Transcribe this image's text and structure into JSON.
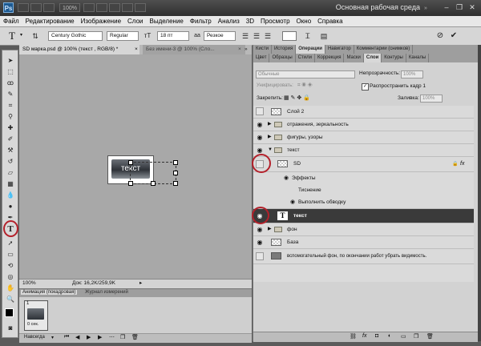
{
  "titlebar": {
    "logo": "Ps",
    "zoom": "100%",
    "workspace": "Основная рабочая среда",
    "win_minimize": "–",
    "win_restore": "❐",
    "win_close": "✕"
  },
  "menu": [
    "Файл",
    "Редактирование",
    "Изображение",
    "Слои",
    "Выделение",
    "Фильтр",
    "Анализ",
    "3D",
    "Просмотр",
    "Окно",
    "Справка"
  ],
  "options": {
    "tool_glyph": "T",
    "font_family": "Century Gothic",
    "font_style": "Regular",
    "font_size": "18 пт",
    "aa": "Резкое"
  },
  "document": {
    "tab1": "SD марка.psd @ 100% (текст , RGB/8) *",
    "tab1_close": "×",
    "tab2": "Без имени-3 @ 100% (Сло...",
    "tab2_close": "×",
    "tab_more": "»",
    "canvas_text": "текст",
    "zoom": "100%",
    "doc_info": "Док: 16,2K/259,9K"
  },
  "animation": {
    "tab_anim": "Анимация (покадровая)",
    "tab_log": "Журнал измерений",
    "frame_number": "1",
    "frame_delay": "0 сек.",
    "loop": "Навсегда"
  },
  "panels": {
    "tabs_top": [
      "Кисти",
      "История",
      "Операции",
      "Навигатор",
      "Комментарии (снимков)"
    ],
    "tabs_layers": [
      "Цвет",
      "Образцы",
      "Стили",
      "Коррекция",
      "Маски",
      "Слои",
      "Контуры",
      "Каналы"
    ],
    "blend_mode": "Обычные",
    "opacity_label": "Непрозрачность:",
    "opacity_value": "100%",
    "unify_label": "Унифицировать:",
    "propagate_label": "Распространить кадр 1",
    "lock_label": "Закрепить:",
    "fill_label": "Заливка:",
    "fill_value": "100%"
  },
  "layers": [
    {
      "name": "Слой 2",
      "type": "layer",
      "visible": false,
      "indent": 0
    },
    {
      "name": "отражения, зеркальность",
      "type": "group",
      "visible": true,
      "indent": 0
    },
    {
      "name": "фигуры, узоры",
      "type": "group",
      "visible": true,
      "indent": 0
    },
    {
      "name": "текст",
      "type": "group",
      "visible": true,
      "indent": 0,
      "open": true
    },
    {
      "name": "SD",
      "type": "layer",
      "visible": false,
      "indent": 1,
      "fx": "fx"
    },
    {
      "name": "Эффекты",
      "type": "effect",
      "indent": 2
    },
    {
      "name": "Тиснение",
      "type": "effect-item",
      "indent": 3
    },
    {
      "name": "Выполнить обводку",
      "type": "effect-item",
      "indent": 3
    },
    {
      "name": "текст",
      "type": "text",
      "visible": true,
      "indent": 1,
      "selected": true,
      "glyph": "T"
    },
    {
      "name": "фон",
      "type": "group",
      "visible": true,
      "indent": 0
    },
    {
      "name": "База",
      "type": "layer",
      "visible": true,
      "indent": 0
    },
    {
      "name": "вспомогательный фон, по окончании работ убрать видимость.",
      "type": "layer-gray",
      "visible": false,
      "indent": 0
    }
  ],
  "colors": {
    "accent_red": "#b3202a",
    "selected_row": "#3a3a3a",
    "ps_blue": "#1d5a92"
  }
}
